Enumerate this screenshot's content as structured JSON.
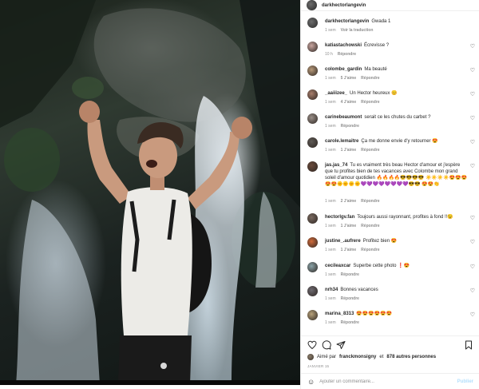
{
  "post": {
    "author": "darkhectorlangevin",
    "caption_author": "darkhectorlangevin",
    "caption": "Gwada 1",
    "caption_translate": "Voir la traduction",
    "caption_time": "1 sem"
  },
  "comments": [
    {
      "user": "katiastachowski",
      "text": "Écrevisse ?",
      "time": "10 h",
      "likes": "",
      "reply": "Répondre",
      "avatar_color": "#c9a6a0"
    },
    {
      "user": "colombe_gardin",
      "text": "Ma beauté",
      "time": "1 sem",
      "likes": "5 J'aime",
      "reply": "Répondre",
      "avatar_color": "#b89a7a"
    },
    {
      "user": "_aaiiizee_",
      "text": "Un Hector heureux 😊",
      "time": "1 sem",
      "likes": "4 J'aime",
      "reply": "Répondre",
      "avatar_color": "#a87e6b"
    },
    {
      "user": "carinebeaumont",
      "text": "serait ce les chutes du carbet ?",
      "time": "1 sem",
      "likes": "",
      "reply": "Répondre",
      "avatar_color": "#9a8f88"
    },
    {
      "user": "carole.lemaitre",
      "text": "Ça me donne envie d'y retourner 😍",
      "time": "1 sem",
      "likes": "1 J'aime",
      "reply": "Répondre",
      "avatar_color": "#5f5a55"
    },
    {
      "user": "jas.jas_74",
      "text": "Tu es vraiment très beau Hector d'amour et j'espère que tu profites bien de tes vacances avec Colombe mon grand soleil d'amour quotidien 🔥🔥🔥🔥😎😎😎😎 ☀️☀️☀️☀️😍😍😍😍😍🌞🌞🌞🌞💜💜💜💜💜💜💜💜😎😎 😍😍👏",
      "time": "1 sem",
      "likes": "2 J'aime",
      "reply": "Répondre",
      "avatar_color": "#6b4b3c"
    },
    {
      "user": "hectorlgv.fan",
      "text": "Toujours aussi rayonnant, profites à fond !!😉",
      "time": "1 sem",
      "likes": "1 J'aime",
      "reply": "Répondre",
      "avatar_color": "#7a6a60"
    },
    {
      "user": "justine_.aufrere",
      "text": "Profitez bien 😍",
      "time": "1 sem",
      "likes": "1 J'aime",
      "reply": "Répondre",
      "avatar_color": "#d06a3a"
    },
    {
      "user": "cecileaxcar",
      "text": "Superbe cette photo ❗😍",
      "time": "1 sem",
      "likes": "",
      "reply": "Répondre",
      "avatar_color": "#8aa3a8"
    },
    {
      "user": "nrh34",
      "text": "Bonnes vacances",
      "time": "1 sem",
      "likes": "",
      "reply": "Répondre",
      "avatar_color": "#6e6a70"
    },
    {
      "user": "marina_8313",
      "text": "😍😍😍😍😍😍",
      "time": "1 sem",
      "likes": "",
      "reply": "Répondre",
      "avatar_color": "#b8a27a"
    }
  ],
  "actions": {
    "like_icon": "heart-icon",
    "comment_icon": "comment-icon",
    "share_icon": "share-icon",
    "save_icon": "bookmark-icon"
  },
  "likes": {
    "prefix": "Aimé par",
    "user": "franckmonsigny",
    "middle": "et",
    "others": "878 autres personnes"
  },
  "date": "JANVIER 15",
  "add_comment": {
    "emoji_icon": "smiley-icon",
    "placeholder": "Ajouter un commentaire...",
    "publish_label": "Publier",
    "publish_color": "#b2dffc"
  }
}
